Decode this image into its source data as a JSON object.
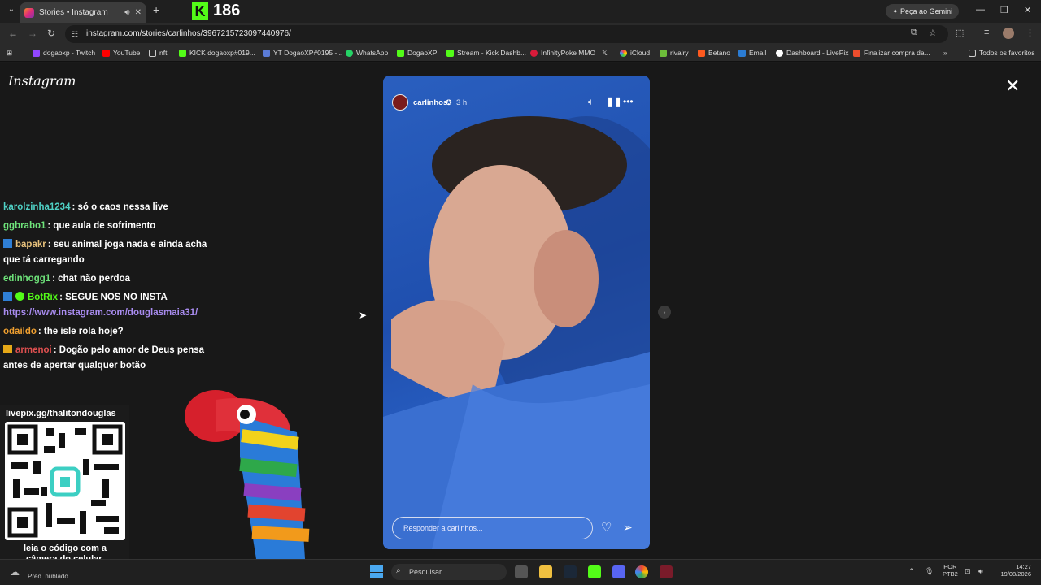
{
  "browser": {
    "tab": {
      "title": "Stories • Instagram"
    },
    "kick_counter": "186",
    "gemini_button": "Peça ao Gemini",
    "url": "instagram.com/stories/carlinhos/3967215723097440976/",
    "bookmarks": [
      "dogaoxp - Twitch",
      "YouTube",
      "nft",
      "KICK dogaoxp#019...",
      "YT DogaoXP#0195 -...",
      "WhatsApp",
      "DogaoXP",
      "Stream - Kick Dashb...",
      "InfinityPoke MMO",
      "iCloud",
      "rivalry",
      "Betano",
      "Email",
      "Dashboard - LivePix",
      "Finalizar compra da..."
    ],
    "all_bookmarks": "Todos os favoritos"
  },
  "instagram": {
    "logo": "Instagram",
    "story": {
      "username": "carlinhos",
      "time": "3 h",
      "reply_placeholder": "Responder a carlinhos..."
    }
  },
  "chat": [
    {
      "user": "karolzinha1234",
      "user_color": "#4fd1c5",
      "message": ": só o caos nessa live",
      "badge": ""
    },
    {
      "user": "ggbrabo1",
      "user_color": "#6ee37a",
      "message": ": que aula de sofrimento",
      "badge": ""
    },
    {
      "user": "bapakr",
      "user_color": "#e6c07b",
      "message": ": seu animal joga nada e ainda acha",
      "message2": "que tá carregando",
      "badge": "blue"
    },
    {
      "user": "edinhogg1",
      "user_color": "#6ee37a",
      "message": ": chat não perdoa",
      "badge": ""
    },
    {
      "user": "BotRix",
      "user_color": "#53fc18",
      "message": ": SEGUE NOS NO INSTA",
      "message2": "https://www.instagram.com/douglasmaia31/",
      "badge": "blue-green"
    },
    {
      "user": "odaildo",
      "user_color": "#f0a030",
      "message": ": the isle rola hoje?",
      "badge": ""
    },
    {
      "user": "armenoi",
      "user_color": "#e05050",
      "message": ": Dogão pelo amor de Deus pensa",
      "message2": "antes de apertar qualquer botão",
      "badge": "crown"
    }
  ],
  "qr": {
    "url": "livepix.gg/thalitondouglas",
    "caption": "leia o código com a câmera do celular."
  },
  "taskbar": {
    "weather": "Pred. nublado",
    "search_placeholder": "Pesquisar",
    "lang_line1": "POR",
    "lang_line2": "PTB2",
    "time": "14:27",
    "date": "19/08/2026"
  }
}
